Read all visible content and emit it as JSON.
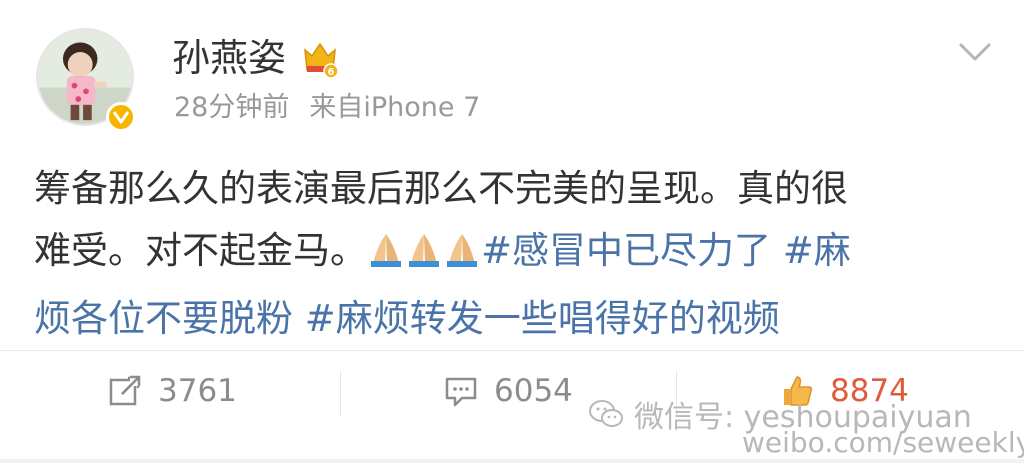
{
  "post": {
    "author": "孙燕姿",
    "time": "28分钟前",
    "source": "来自iPhone 7",
    "content": {
      "line1": "筹备那么久的表演最后那么不完美的呈现。真的很",
      "line2_text": "难受。对不起金马。",
      "emoji": "🙏🙏🙏",
      "hashtag1": "#感冒中已尽力了",
      "line2_tail": " #麻",
      "line3_hashtag2_tail": "烦各位不要脱粉",
      "hashtag3": " #麻烦转发一些唱得好的视频"
    }
  },
  "actions": {
    "repost_count": "3761",
    "comment_count": "6054",
    "like_count": "8874"
  },
  "watermark": {
    "wechat": "微信号: yeshoupaiyuan",
    "weibo": "weibo.com/seweekly"
  },
  "icons": {
    "repost": "repost-icon",
    "comment": "comment-icon",
    "like": "like-icon",
    "crown": "crown-badge-icon",
    "verified": "verified-v-icon",
    "chevron": "chevron-down-icon",
    "wechat": "wechat-icon"
  },
  "colors": {
    "text": "#333333",
    "meta": "#999999",
    "hashtag": "#4a73a8",
    "like": "#e05b3c",
    "verified": "#f7b500"
  }
}
